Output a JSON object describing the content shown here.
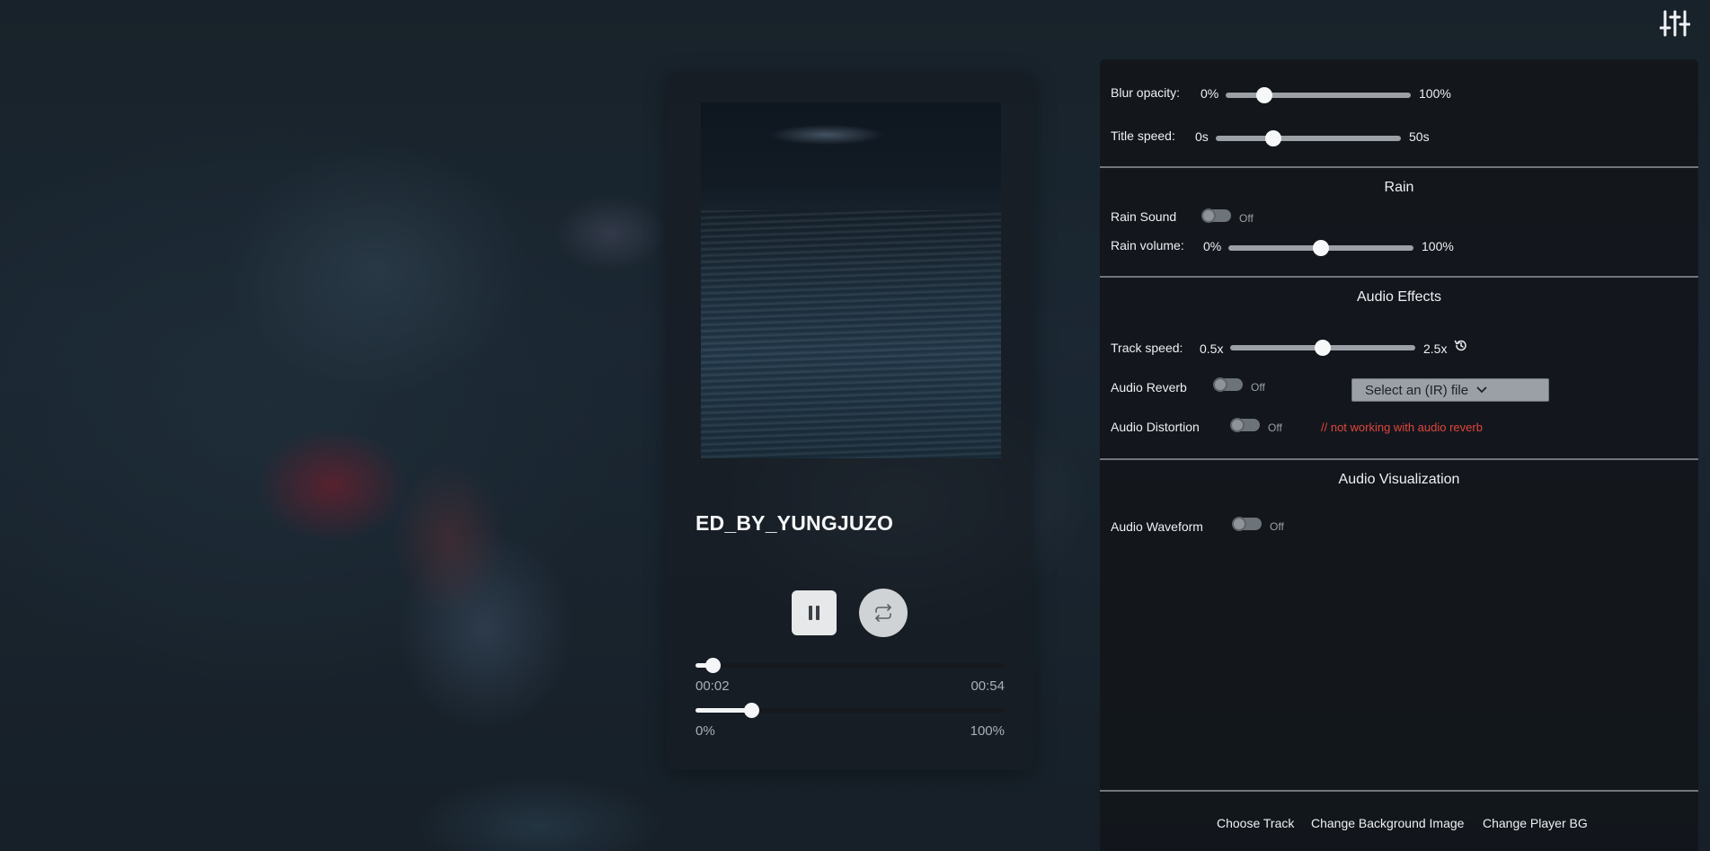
{
  "player": {
    "track_title": "ED_BY_YUNGJUZO",
    "progress": {
      "current": "00:02",
      "total": "00:54",
      "fraction": 0.055
    },
    "volume": {
      "min_label": "0%",
      "max_label": "100%",
      "fraction": 0.18
    },
    "buttons": {
      "pause_icon": "pause-icon",
      "repeat_icon": "repeat-icon"
    }
  },
  "settings": {
    "toggle_icon": "sliders-icon",
    "blur_opacity": {
      "label": "Blur opacity:",
      "min": "0%",
      "max": "100%",
      "fraction": 0.21
    },
    "title_speed": {
      "label": "Title speed:",
      "min": "0s",
      "max": "50s",
      "fraction": 0.31
    },
    "rain": {
      "title": "Rain",
      "sound_label": "Rain Sound",
      "sound_state": "Off",
      "volume_label": "Rain volume:",
      "volume_min": "0%",
      "volume_max": "100%",
      "volume_fraction": 0.5
    },
    "audio_effects": {
      "title": "Audio Effects",
      "speed_label": "Track speed:",
      "speed_min": "0.5x",
      "speed_max": "2.5x",
      "speed_fraction": 0.5,
      "reset_icon": "reset-history-icon",
      "reverb_label": "Audio Reverb",
      "reverb_state": "Off",
      "ir_select": "Select an (IR) file",
      "distortion_label": "Audio Distortion",
      "distortion_state": "Off",
      "distortion_warning": "// not working with audio reverb"
    },
    "visualization": {
      "title": "Audio Visualization",
      "waveform_label": "Audio Waveform",
      "waveform_state": "Off"
    },
    "footer": {
      "choose_track": "Choose Track",
      "change_bg": "Change Background Image",
      "change_player_bg": "Change Player BG"
    }
  }
}
